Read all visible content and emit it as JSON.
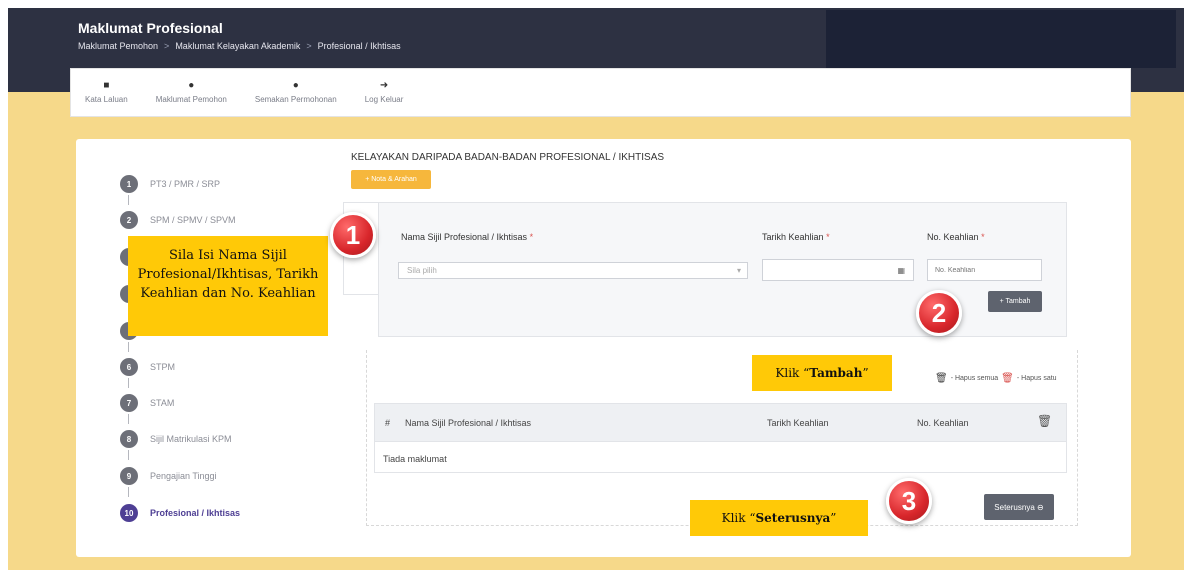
{
  "header": {
    "title": "Maklumat Profesional",
    "breadcrumb": [
      "Maklumat Pemohon",
      "Maklumat Kelayakan Akademik",
      "Profesional / Ikhtisas"
    ],
    "breadcrumb_sep": ">"
  },
  "topnav": [
    {
      "label": "Kata Laluan",
      "icon": "lock-icon",
      "glyph": "🔒"
    },
    {
      "label": "Maklumat Pemohon",
      "icon": "user-gear-icon",
      "glyph": "👤"
    },
    {
      "label": "Semakan Permohonan",
      "icon": "user-check-icon",
      "glyph": "👤"
    },
    {
      "label": "Log Keluar",
      "icon": "logout-icon",
      "glyph": "↪"
    }
  ],
  "steps": [
    {
      "num": "1",
      "label": "PT3 / PMR / SRP"
    },
    {
      "num": "2",
      "label": "SPM / SPMV / SPVM"
    },
    {
      "num": "6",
      "label": "STPM"
    },
    {
      "num": "7",
      "label": "STAM"
    },
    {
      "num": "8",
      "label": "Sijil Matrikulasi KPM"
    },
    {
      "num": "9",
      "label": "Pengajian Tinggi"
    },
    {
      "num": "10",
      "label": "Profesional / Ikhtisas"
    }
  ],
  "section_title": "KELAYAKAN DARIPADA BADAN-BADAN PROFESIONAL / IKHTISAS",
  "nota_button": "+ Nota & Arahan",
  "form": {
    "nama_label": "Nama Sijil Profesional / Ikhtisas",
    "tarikh_label": "Tarikh Keahlian",
    "no_label": "No. Keahlian",
    "required_mark": "*",
    "select_placeholder": "Sila pilih",
    "no_placeholder": "No. Keahlian",
    "tambah_button": "+ Tambah"
  },
  "actions": {
    "hapus_semua": "- Hapus semua",
    "hapus_satu": "- Hapus satu"
  },
  "table": {
    "headers": [
      "#",
      "Nama Sijil Profesional / Ikhtisas",
      "Tarikh Keahlian",
      "No. Keahlian"
    ],
    "empty_text": "Tiada maklumat"
  },
  "next_button": "Seterusnya ⊖",
  "callouts": {
    "one": "Sila Isi Nama Sijil Profesional/Ikhtisas, Tarikh Keahlian dan No. Keahlian",
    "two_prefix": "Klik “",
    "two_bold": "Tambah",
    "two_suffix": "”",
    "three_prefix": "Klik “",
    "three_bold": "Seterusnya",
    "three_suffix": "”"
  },
  "badges": [
    "1",
    "2",
    "3"
  ],
  "colors": {
    "background": "#f6d98a",
    "header": "#2d3142",
    "accent": "#4e3f94",
    "callout": "#ffc907",
    "badge": "#d8262b",
    "nota_button": "#f6b73c"
  }
}
